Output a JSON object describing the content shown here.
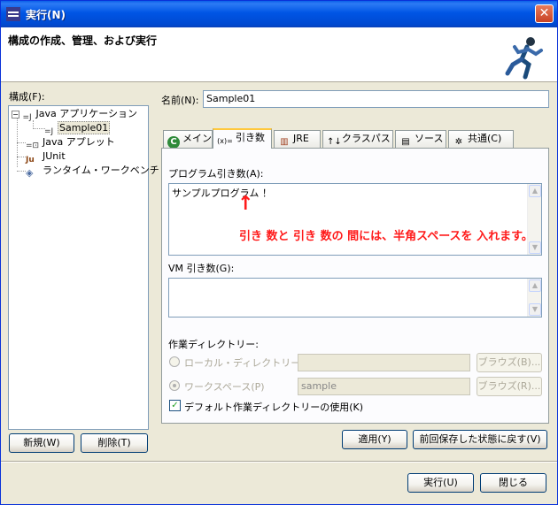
{
  "window": {
    "title": "実行(N)",
    "heading": "構成の作成、管理、および実行"
  },
  "left": {
    "label": "構成(F):",
    "tree": [
      {
        "label": "Java アプリケーション"
      },
      {
        "label": "Sample01"
      },
      {
        "label": "Java アプレット"
      },
      {
        "label": "JUnit"
      },
      {
        "label": "ランタイム・ワークベンチ"
      }
    ],
    "new_button": "新規(W)",
    "delete_button": "削除(T)"
  },
  "main": {
    "name_label": "名前(N):",
    "name_value": "Sample01",
    "tabs": [
      {
        "label": "メイン",
        "icon": "C"
      },
      {
        "label": "引き数",
        "icon": "(x)="
      },
      {
        "label": "JRE",
        "icon": "books"
      },
      {
        "label": "クラスパス",
        "icon": "↑↓"
      },
      {
        "label": "ソース",
        "icon": "doc"
      },
      {
        "label": "共通(C)",
        "icon": "gear"
      }
    ],
    "program_args_label": "プログラム引き数(A):",
    "program_args_value": "サンプルプログラム ！",
    "annotation_arrow": "↑",
    "annotation_text": "引き 数と 引き 数の 間には、半角スペースを 入れます。",
    "vm_args_label": "VM 引き数(G):",
    "vm_args_value": "",
    "workdir_label": "作業ディレクトリー:",
    "local_dir_label": "ローカル・ディレクトリー(L):",
    "local_dir_value": "",
    "browse1": "ブラウズ(B)...",
    "workspace_label": "ワークスペース(P)",
    "workspace_value": "sample",
    "browse2": "ブラウズ(R)...",
    "default_dir_label": "デフォルト作業ディレクトリーの使用(K)",
    "default_dir_checked": true,
    "apply_button": "適用(Y)",
    "revert_button": "前回保存した状態に戻す(V)"
  },
  "footer": {
    "run_button": "実行(U)",
    "close_button": "閉じる"
  },
  "colors": {
    "titlebar": "#0055e5",
    "annotation": "#ff1a1a",
    "tab_highlight": "#ffc83c"
  }
}
